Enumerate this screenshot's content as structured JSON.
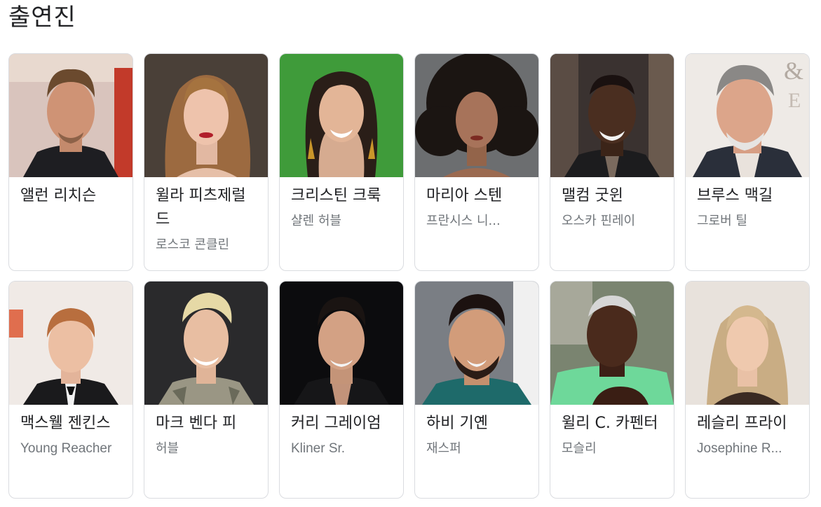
{
  "section": {
    "title": "출연진"
  },
  "cast": [
    {
      "name": "앨런 리치슨",
      "role": ""
    },
    {
      "name": "윌라 피츠제럴드",
      "role": "로스코 콘클린"
    },
    {
      "name": "크리스틴 크룩",
      "role": "샬렌 허블"
    },
    {
      "name": "마리아 스텐",
      "role": "프란시스 니..."
    },
    {
      "name": "맬컴 굿윈",
      "role": "오스카 핀레이"
    },
    {
      "name": "브루스 맥길",
      "role": "그로버 틸"
    },
    {
      "name": "맥스웰 젠킨스",
      "role": "Young Reacher"
    },
    {
      "name": "마크 벤다 피",
      "role": "허블"
    },
    {
      "name": "커리 그레이엄",
      "role": "Kliner Sr."
    },
    {
      "name": "하비 기옌",
      "role": "재스퍼"
    },
    {
      "name": "윌리 C. 카펜터",
      "role": "모슬리"
    },
    {
      "name": "레슬리 프라이",
      "role": "Josephine R..."
    }
  ],
  "colors": {
    "card_border": "#dadce0",
    "name_text": "#202124",
    "role_text": "#70757a"
  }
}
